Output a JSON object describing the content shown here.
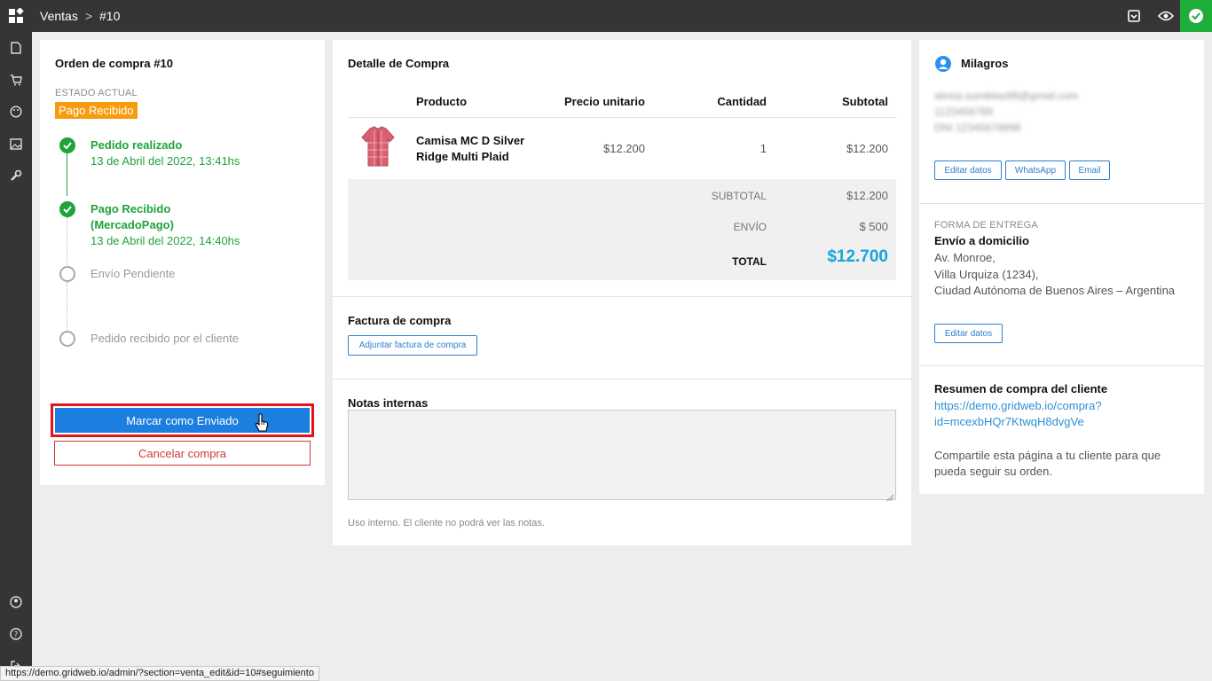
{
  "topbar": {
    "breadcrumb_section": "Ventas",
    "breadcrumb_separator": ">",
    "breadcrumb_item": "#10",
    "status_color": "#1fae3c"
  },
  "sidebar": {
    "items": [
      "file-icon",
      "cart-icon",
      "palette-icon",
      "image-icon",
      "wrench-icon"
    ],
    "bottom_items": [
      "user-circle-icon",
      "help-icon",
      "logout-icon"
    ]
  },
  "order": {
    "title": "Orden de compra #10",
    "estado_caption": "ESTADO ACTUAL",
    "estado_badge": "Pago Recibido",
    "badge_color": "#f79c0e",
    "steps": [
      {
        "title": "Pedido realizado",
        "date": "13 de Abril del 2022, 13:41hs",
        "done": true
      },
      {
        "title": "Pago Recibido",
        "title2": "(MercadoPago)",
        "date": "13 de Abril del 2022, 14:40hs",
        "done": true
      },
      {
        "title": "Envío Pendiente",
        "done": false
      },
      {
        "title": "Pedido recibido por el cliente",
        "done": false
      }
    ],
    "primary_button": "Marcar como Enviado",
    "cancel_button": "Cancelar compra"
  },
  "detail": {
    "title": "Detalle de Compra",
    "columns": [
      "Producto",
      "Precio unitario",
      "Cantidad",
      "Subtotal"
    ],
    "rows": [
      {
        "product_line1": "Camisa MC D Silver",
        "product_line2": "Ridge Multi Plaid",
        "price": "$12.200",
        "qty": "1",
        "subtotal": "$12.200"
      }
    ],
    "summary": {
      "subtotal_label": "SUBTOTAL",
      "subtotal_value": "$12.200",
      "envio_label": "ENVÍO",
      "envio_value": "$ 500",
      "total_label": "TOTAL",
      "total_value": "$12.700",
      "total_color": "#1aa3dc"
    },
    "invoice_title": "Factura de compra",
    "invoice_button": "Adjuntar factura de compra",
    "notes_title": "Notas internas",
    "notes_value": "",
    "notes_hint": "Uso interno. El cliente no podrá ver las notas."
  },
  "customer": {
    "name": "Milagros",
    "email": "alexia.sumiblas98@gmail.com",
    "phone": "1123456789",
    "dni": "DNI 12345678898",
    "buttons": [
      "Editar datos",
      "WhatsApp",
      "Email"
    ],
    "delivery_caption": "FORMA DE ENTREGA",
    "delivery_method": "Envío a domicilio",
    "address_line1": "Av. Monroe,",
    "address_line2": "Villa Urquiza (1234),",
    "address_line3": "Ciudad Autónoma de Buenos Aires – Argentina",
    "delivery_edit_button": "Editar datos",
    "summary_title": "Resumen de compra del cliente",
    "summary_link_line1": "https://demo.gridweb.io/compra?",
    "summary_link_line2": "id=mcexbHQr7KtwqH8dvgVe",
    "share_line1": "Compartile esta página a tu cliente para que",
    "share_line2": "pueda seguir su orden."
  },
  "statusbar": {
    "url": "https://demo.gridweb.io/admin/?section=venta_edit&id=10#seguimiento"
  }
}
